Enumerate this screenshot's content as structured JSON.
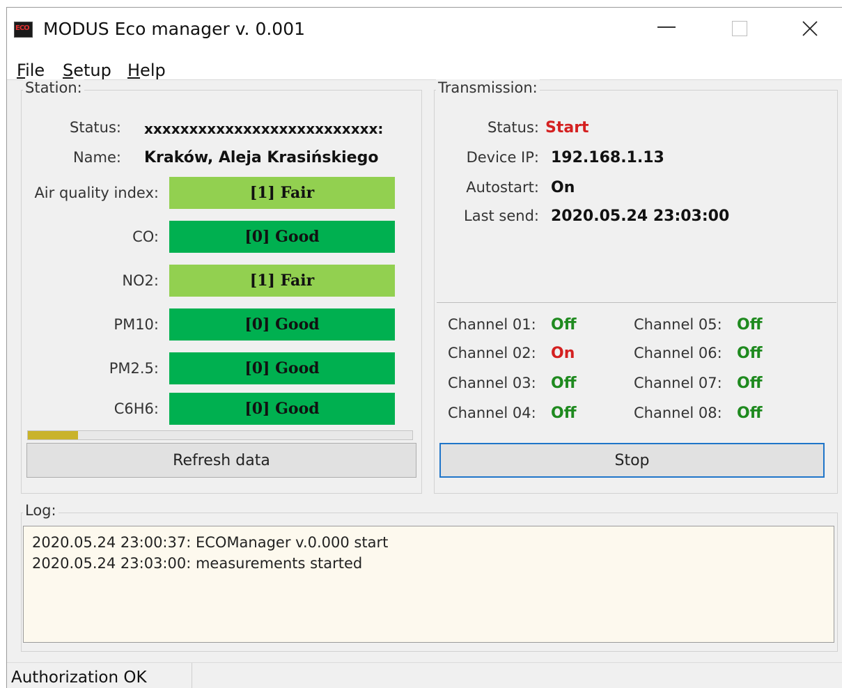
{
  "window": {
    "title": "MODUS Eco manager v. 0.001",
    "icon_text": "ECO",
    "minimize_glyph": "—",
    "close_glyph": "✕"
  },
  "menu": {
    "items": [
      {
        "label": "File"
      },
      {
        "label": "Setup"
      },
      {
        "label": "Help"
      }
    ]
  },
  "station": {
    "group_label": "Station:",
    "status_label": "Status:",
    "status_value": "xxxxxxxxxxxxxxxxxxxxxxxxxx:",
    "name_label": "Name:",
    "name_value": "Kraków, Aleja Krasińskiego",
    "indices": [
      {
        "label": "Air quality index:",
        "value": "[1] Fair",
        "color": "#92d050"
      },
      {
        "label": "CO:",
        "value": "[0] Good",
        "color": "#00b050"
      },
      {
        "label": "NO2:",
        "value": "[1] Fair",
        "color": "#92d050"
      },
      {
        "label": "PM10:",
        "value": "[0] Good",
        "color": "#00b050"
      },
      {
        "label": "PM2.5:",
        "value": "[0] Good",
        "color": "#00b050"
      },
      {
        "label": "C6H6:",
        "value": "[0] Good",
        "color": "#00b050"
      }
    ],
    "progress_fraction": 0.13,
    "refresh_button": "Refresh data"
  },
  "transmission": {
    "group_label": "Transmission:",
    "status_label": "Status:",
    "status_value": "Start",
    "status_color": "#d42020",
    "device_ip_label": "Device IP:",
    "device_ip_value": "192.168.1.13",
    "autostart_label": "Autostart:",
    "autostart_value": "On",
    "last_send_label": "Last send:",
    "last_send_value": "2020.05.24 23:03:00",
    "channels": [
      {
        "label": "Channel 01:",
        "value": "Off",
        "color": "#1f8a1f"
      },
      {
        "label": "Channel 02:",
        "value": "On",
        "color": "#d42020"
      },
      {
        "label": "Channel 03:",
        "value": "Off",
        "color": "#1f8a1f"
      },
      {
        "label": "Channel 04:",
        "value": "Off",
        "color": "#1f8a1f"
      },
      {
        "label": "Channel 05:",
        "value": "Off",
        "color": "#1f8a1f"
      },
      {
        "label": "Channel 06:",
        "value": "Off",
        "color": "#1f8a1f"
      },
      {
        "label": "Channel 07:",
        "value": "Off",
        "color": "#1f8a1f"
      },
      {
        "label": "Channel 08:",
        "value": "Off",
        "color": "#1f8a1f"
      }
    ],
    "stop_button": "Stop"
  },
  "log": {
    "group_label": "Log:",
    "lines": [
      "2020.05.24 23:00:37: ECOManager v.0.000 start",
      "2020.05.24 23:03:00: measurements started"
    ]
  },
  "statusbar": {
    "text": "Authorization OK"
  }
}
